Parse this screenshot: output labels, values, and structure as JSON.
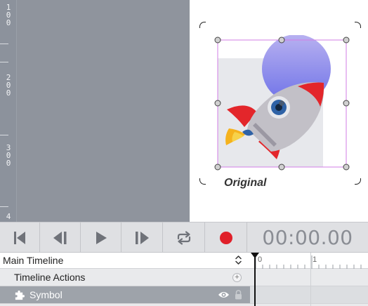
{
  "ruler": {
    "labels": [
      "1\n0\n0",
      "2\n0\n0",
      "3\n0\n0",
      "4"
    ]
  },
  "stage": {
    "caption": "Original"
  },
  "transport": {
    "buttons": [
      "skip-to-start",
      "step-backward",
      "play",
      "step-forward",
      "loop",
      "record"
    ],
    "timecode": "00:00.00",
    "record_color": "#e0202a"
  },
  "timeline": {
    "main_title": "Main Timeline",
    "actions_label": "Timeline Actions",
    "add_symbol": "+",
    "symbol_label": "Symbol",
    "ruler_marks": [
      "0",
      "1"
    ]
  },
  "colors": {
    "selection": "#d27ee6",
    "circle_top": "#b8b1f0",
    "circle_bottom": "#6e72e8",
    "rocket_body": "#c2c0c7",
    "rocket_red": "#e3262b",
    "flame": "#f5b21d"
  }
}
